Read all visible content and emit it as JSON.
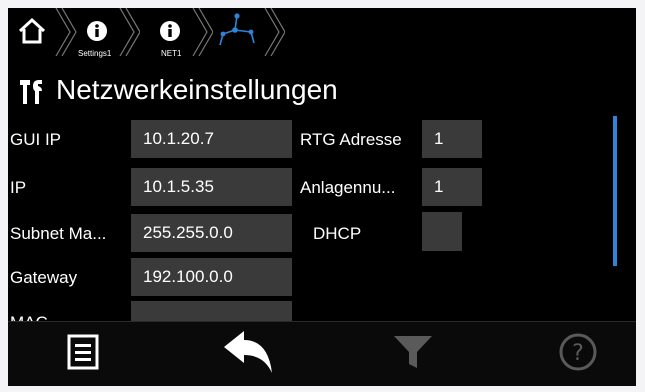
{
  "breadcrumbs": [
    {
      "icon": "home-icon",
      "label": ""
    },
    {
      "icon": "info-icon",
      "label": "Settings1"
    },
    {
      "icon": "info-icon",
      "label": "NET1"
    },
    {
      "icon": "network-icon",
      "label": ""
    }
  ],
  "page": {
    "title": "Netzwerkeinstellungen",
    "icon": "tools-icon"
  },
  "fields": {
    "gui_ip": {
      "label": "GUI IP",
      "value": "10.1.20.7"
    },
    "ip": {
      "label": "IP",
      "value": "10.1.5.35"
    },
    "subnet": {
      "label": "Subnet Ma...",
      "value": "255.255.0.0"
    },
    "gateway": {
      "label": "Gateway",
      "value": "192.100.0.0"
    },
    "mac": {
      "label": "MAC",
      "value": ""
    },
    "rtg_adresse": {
      "label": "RTG Adresse",
      "value": "1"
    },
    "anlagennummer": {
      "label": "Anlagennu...",
      "value": "1"
    },
    "dhcp": {
      "label": "DHCP",
      "checked": false
    }
  },
  "bottombar": [
    {
      "icon": "menu-list-icon",
      "enabled": true
    },
    {
      "icon": "back-arrow-icon",
      "enabled": true
    },
    {
      "icon": "filter-icon",
      "enabled": false
    },
    {
      "icon": "help-icon",
      "enabled": false
    }
  ],
  "colors": {
    "background": "#000000",
    "field": "#3a3a3a",
    "accent": "#2e84d6",
    "text": "#ffffff",
    "disabled": "#5a5a5a"
  }
}
